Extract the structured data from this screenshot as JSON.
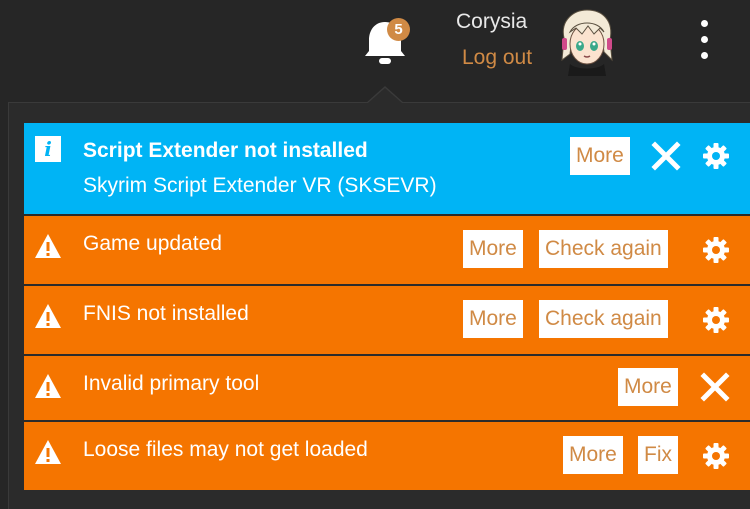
{
  "header": {
    "notification_count": "5",
    "user_name": "Corysia",
    "logout_label": "Log out"
  },
  "notifications": [
    {
      "type": "info",
      "icon": "info-icon",
      "title": "Script Extender not installed",
      "subtitle": "Skyrim Script Extender VR (SKSEVR)",
      "buttons": [
        "More"
      ],
      "has_dismiss": true,
      "has_settings": true
    },
    {
      "type": "warning",
      "icon": "warning-icon",
      "title": "Game updated",
      "buttons": [
        "More",
        "Check again"
      ],
      "has_dismiss": false,
      "has_settings": true
    },
    {
      "type": "warning",
      "icon": "warning-icon",
      "title": "FNIS not installed",
      "buttons": [
        "More",
        "Check again"
      ],
      "has_dismiss": false,
      "has_settings": true
    },
    {
      "type": "warning",
      "icon": "warning-icon",
      "title": "Invalid primary tool",
      "buttons": [
        "More"
      ],
      "has_dismiss": true,
      "has_settings": false
    },
    {
      "type": "warning",
      "icon": "warning-icon",
      "title": "Loose files may not get loaded",
      "buttons": [
        "More",
        "Fix"
      ],
      "has_dismiss": false,
      "has_settings": true
    }
  ],
  "colors": {
    "background": "#262626",
    "info": "#00b4f5",
    "warning": "#f57500",
    "accent": "#d08a45",
    "button_bg": "#ffffff"
  }
}
